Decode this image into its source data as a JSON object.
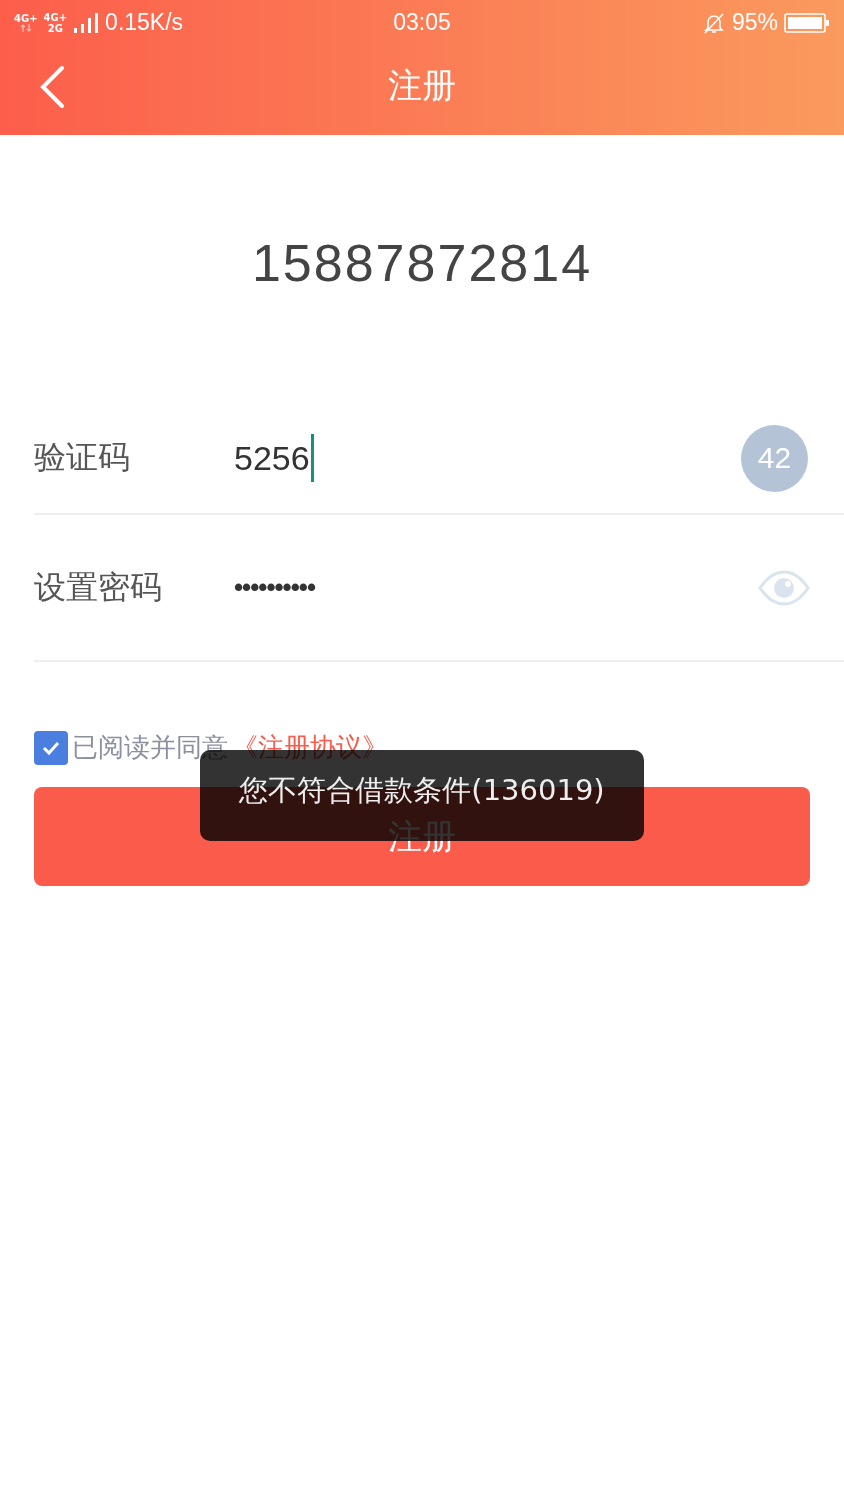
{
  "status_bar": {
    "network_labels": [
      "4G+",
      "4G+",
      "2G"
    ],
    "speed": "0.15K/s",
    "time": "03:05",
    "battery": "95%"
  },
  "nav": {
    "title": "注册"
  },
  "phone": "15887872814",
  "fields": [
    {
      "kind": "code",
      "label": "验证码",
      "value": "5256",
      "countdown": "42"
    },
    {
      "kind": "password",
      "label": "设置密码",
      "value": "••••••••••"
    }
  ],
  "agreement": {
    "checked": true,
    "text": "已阅读并同意",
    "link": "《注册协议》"
  },
  "submit_button": "注册",
  "toast": "您不符合借款条件(136019)"
}
